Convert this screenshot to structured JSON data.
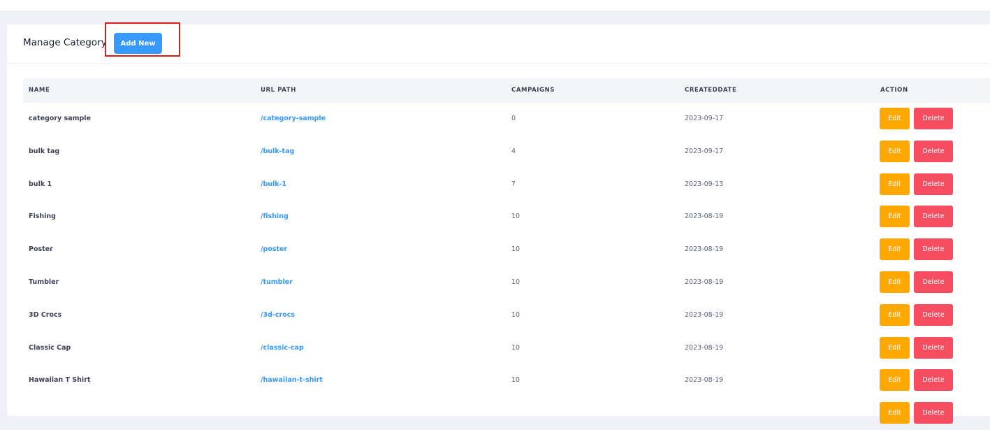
{
  "header": {
    "title": "Manage Category",
    "add_button_label": "Add New"
  },
  "table": {
    "columns": [
      "NAME",
      "URL PATH",
      "CAMPAIGNS",
      "CREATEDDATE",
      "ACTION"
    ],
    "actions": {
      "edit_label": "Edit",
      "delete_label": "Delete"
    },
    "rows": [
      {
        "name": "category sample",
        "url": "/category-sample",
        "campaigns": "0",
        "created": "2023-09-17"
      },
      {
        "name": "bulk tag",
        "url": "/bulk-tag",
        "campaigns": "4",
        "created": "2023-09-17"
      },
      {
        "name": "bulk 1",
        "url": "/bulk-1",
        "campaigns": "7",
        "created": "2023-09-13"
      },
      {
        "name": "Fishing",
        "url": "/fishing",
        "campaigns": "10",
        "created": "2023-08-19"
      },
      {
        "name": "Poster",
        "url": "/poster",
        "campaigns": "10",
        "created": "2023-08-19"
      },
      {
        "name": "Tumbler",
        "url": "/tumbler",
        "campaigns": "10",
        "created": "2023-08-19"
      },
      {
        "name": "3D Crocs",
        "url": "/3d-crocs",
        "campaigns": "10",
        "created": "2023-08-19"
      },
      {
        "name": "Classic Cap",
        "url": "/classic-cap",
        "campaigns": "10",
        "created": "2023-08-19"
      },
      {
        "name": "Hawaiian T Shirt",
        "url": "/hawaiian-t-shirt",
        "campaigns": "10",
        "created": "2023-08-19"
      },
      {
        "name": "",
        "url": "",
        "campaigns": "",
        "created": ""
      }
    ]
  },
  "colors": {
    "primary": "#3699ff",
    "warning": "#ffa800",
    "danger": "#f64e60",
    "highlight": "#dd1b1b"
  }
}
